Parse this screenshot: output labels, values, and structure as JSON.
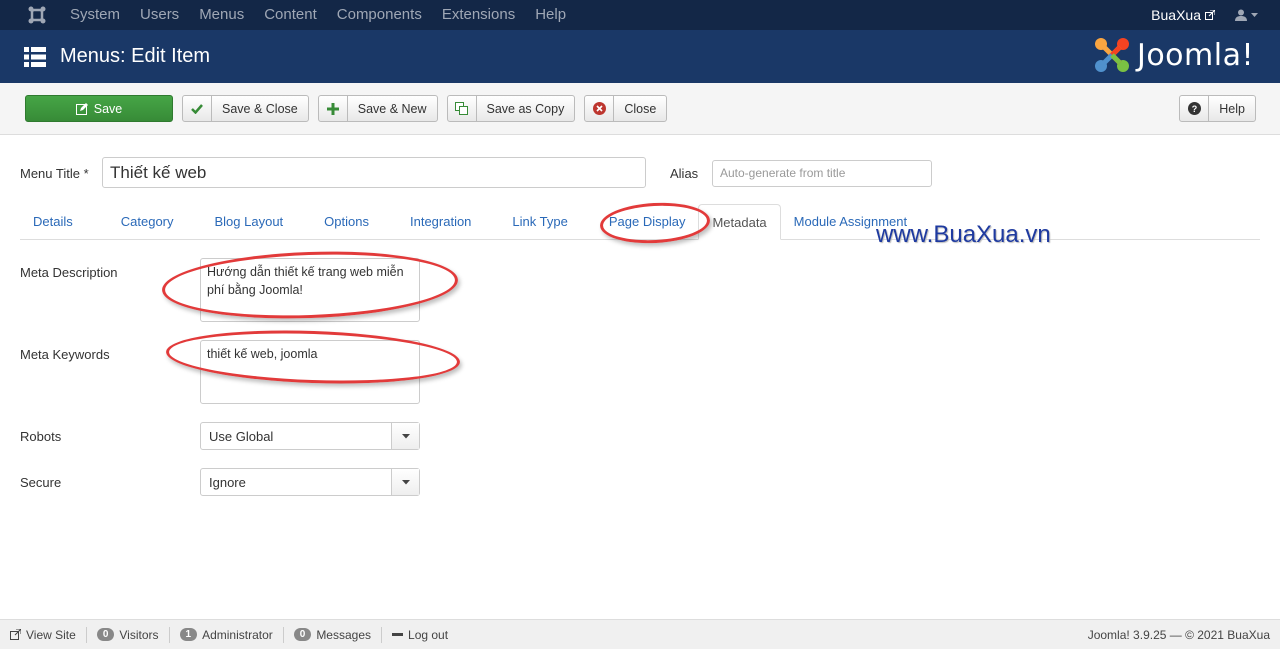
{
  "navbar": {
    "menu": [
      "System",
      "Users",
      "Menus",
      "Content",
      "Components",
      "Extensions",
      "Help"
    ],
    "site_name": "BuaXua"
  },
  "header": {
    "title": "Menus: Edit Item",
    "brand": "Joomla!"
  },
  "toolbar": {
    "save": "Save",
    "save_close": "Save & Close",
    "save_new": "Save & New",
    "save_copy": "Save as Copy",
    "close": "Close",
    "help": "Help"
  },
  "form": {
    "menu_title_label": "Menu Title *",
    "menu_title_value": "Thiết kế web",
    "alias_label": "Alias",
    "alias_placeholder": "Auto-generate from title",
    "tabs": [
      "Details",
      "Category",
      "Blog Layout",
      "Options",
      "Integration",
      "Link Type",
      "Page Display",
      "Metadata",
      "Module Assignment"
    ],
    "active_tab": "Metadata",
    "meta_description_label": "Meta Description",
    "meta_description_value": "Hướng dẫn thiết kế trang web miễn phí bằng Joomla!",
    "meta_keywords_label": "Meta Keywords",
    "meta_keywords_value": "thiết kế web, joomla",
    "robots_label": "Robots",
    "robots_value": "Use Global",
    "secure_label": "Secure",
    "secure_value": "Ignore"
  },
  "watermark": "www.BuaXua.vn",
  "statusbar": {
    "view_site": "View Site",
    "visitors_count": "0",
    "visitors": "Visitors",
    "admin_count": "1",
    "administrator": "Administrator",
    "messages_count": "0",
    "messages": "Messages",
    "logout": "Log out",
    "version": "Joomla! 3.9.25 — © 2021 BuaXua"
  },
  "colors": {
    "navbar": "#132747",
    "header": "#1a3867",
    "save_button": "#46a546",
    "link": "#2a69b8",
    "annotation": "#e23a3a"
  }
}
